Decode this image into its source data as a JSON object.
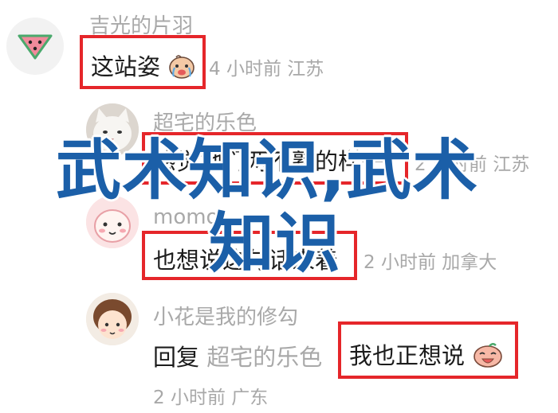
{
  "comments": [
    {
      "name": "吉光的片羽",
      "text": "这站姿",
      "meta": "4 小时前 江苏",
      "avatar_icon": "watermelon-icon",
      "emoji_icon": "crying-face-icon"
    },
    {
      "name": "超宅的乐色",
      "text": "感觉她们两不熟的样子",
      "meta": "2 小时前 江苏",
      "avatar_icon": "cat-photo-avatar"
    },
    {
      "name": "momo",
      "text": "也想说这句话来着",
      "meta": "2 小时前 加拿大",
      "avatar_icon": "cartoon-face-avatar"
    },
    {
      "name": "小花是我的修勾",
      "reply_label": "回复",
      "reply_to": "超宅的乐色",
      "text": "我也正想说",
      "meta": "2 小时前 广东",
      "avatar_icon": "cartoon-girl-avatar",
      "emoji_icon": "laughing-face-icon"
    }
  ],
  "watermark": {
    "line1": "武术知识,武术",
    "line2": "知识"
  },
  "colors": {
    "highlight_border": "#e5262a",
    "watermark_blue": "#1b5fa8",
    "meta_gray": "#a8a8a8"
  }
}
